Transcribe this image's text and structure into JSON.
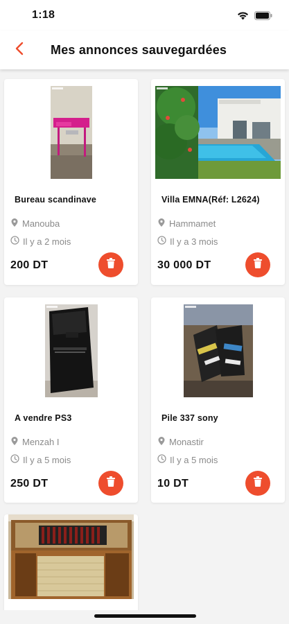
{
  "status_bar": {
    "time": "1:18",
    "icons": [
      "wifi-icon",
      "battery-icon"
    ]
  },
  "header": {
    "back_icon": "chevron-left-icon",
    "title": "Mes annonces sauvegardées"
  },
  "colors": {
    "accent": "#ee4d2d",
    "background": "#f3f3f3",
    "card": "#ffffff",
    "meta_text": "#8a8a8a"
  },
  "listings": [
    {
      "title": "Bureau scandinave",
      "location": "Manouba",
      "time": "Il y a 2 mois",
      "price": "200 DT",
      "image": "pink-desk-photo"
    },
    {
      "title": "Villa EMNA(Réf: L2624)",
      "location": "Hammamet",
      "time": "Il y a 3 mois",
      "price": "30 000 DT",
      "image": "villa-pool-photo"
    },
    {
      "title": "A vendre PS3",
      "location": "Menzah I",
      "time": "Il y a 5 mois",
      "price": "250 DT",
      "image": "ps3-console-photo"
    },
    {
      "title": "Pile 337 sony",
      "location": "Monastir",
      "time": "Il y a 5 mois",
      "price": "10 DT",
      "image": "sony-batteries-photo"
    },
    {
      "image": "vintage-radio-photo"
    }
  ]
}
